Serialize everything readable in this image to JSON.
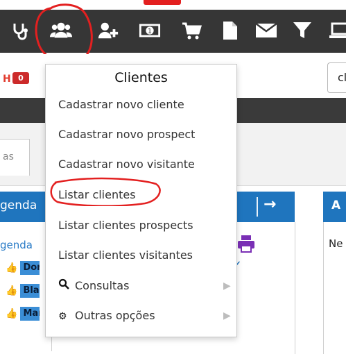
{
  "toolbar": {
    "icons": [
      "stethoscope-icon",
      "users-icon",
      "add-user-icon",
      "money-icon",
      "cart-icon",
      "file-icon",
      "mail-icon",
      "filter-icon",
      "laptop-icon"
    ]
  },
  "header": {
    "brand_fragment": "H",
    "money_badge": "0",
    "search_fragment": "cl"
  },
  "tabs": {
    "fragment_label": "as"
  },
  "panels": {
    "left_title_fragment": "genda",
    "left_link_fragment": "genda",
    "left_items": [
      "Dor",
      "Bla",
      "Mar"
    ],
    "mid_arrow": "→",
    "right_title_fragment": "A",
    "right_text_fragment": "Ne"
  },
  "menu": {
    "title": "Clientes",
    "items": [
      {
        "label": "Cadastrar novo cliente"
      },
      {
        "label": "Cadastrar novo prospect"
      },
      {
        "label": "Cadastrar novo visitante"
      },
      {
        "label": "Listar clientes"
      },
      {
        "label": "Listar clientes prospects"
      },
      {
        "label": "Listar clientes visitantes"
      },
      {
        "label": "Consultas",
        "icon": "search-icon",
        "submenu": true
      },
      {
        "label": "Outras opções",
        "icon": "cog-icon",
        "submenu": true
      }
    ]
  },
  "colors": {
    "toolbar_bg": "#363636",
    "accent_blue": "#1f75be",
    "annotation_red": "#e32020",
    "printer_purple": "#7a2fb5"
  }
}
